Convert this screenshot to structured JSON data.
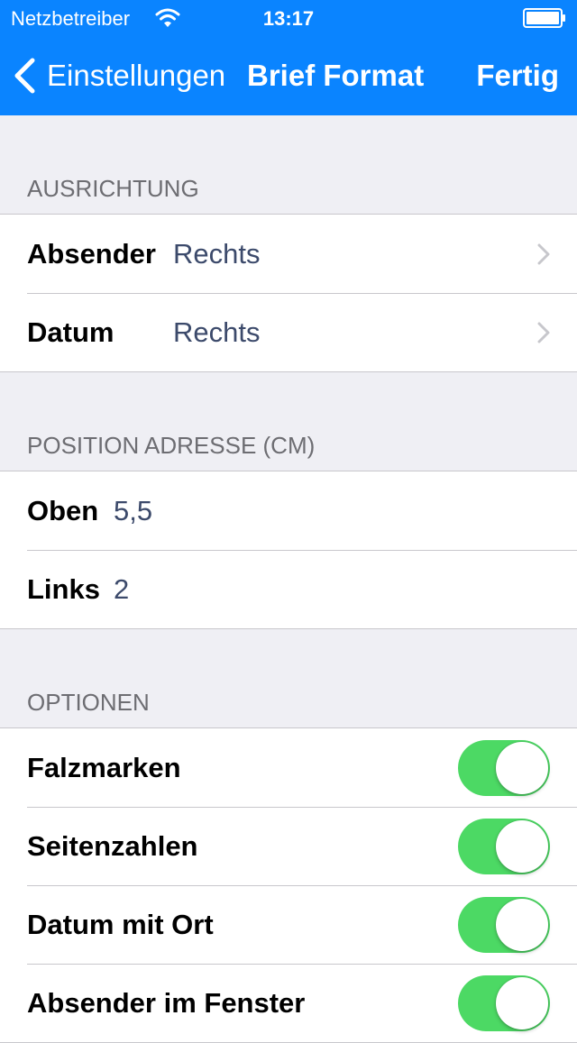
{
  "colors": {
    "accent": "#0a84ff",
    "toggle_on": "#4cd964",
    "value_text": "#3c4a6b",
    "section_header_text": "#6d6d72"
  },
  "status_bar": {
    "carrier": "Netzbetreiber",
    "time": "13:17",
    "wifi_icon": "wifi-icon",
    "battery_icon": "battery-icon"
  },
  "nav": {
    "back_label": "Einstellungen",
    "back_icon": "chevron-left-icon",
    "title": "Brief Format",
    "done_label": "Fertig"
  },
  "sections": {
    "ausrichtung": {
      "header": "AUSRICHTUNG",
      "rows": [
        {
          "label": "Absender",
          "value": "Rechts",
          "icon": "chevron-right-icon"
        },
        {
          "label": "Datum",
          "value": "Rechts",
          "icon": "chevron-right-icon"
        }
      ]
    },
    "position": {
      "header": "POSITION ADRESSE (CM)",
      "rows": [
        {
          "label": "Oben",
          "value": "5,5"
        },
        {
          "label": "Links",
          "value": "2"
        }
      ]
    },
    "optionen": {
      "header": "OPTIONEN",
      "rows": [
        {
          "label": "Falzmarken",
          "on": true
        },
        {
          "label": "Seitenzahlen",
          "on": true
        },
        {
          "label": "Datum mit Ort",
          "on": true
        },
        {
          "label": "Absender im Fenster",
          "on": true
        }
      ]
    }
  }
}
